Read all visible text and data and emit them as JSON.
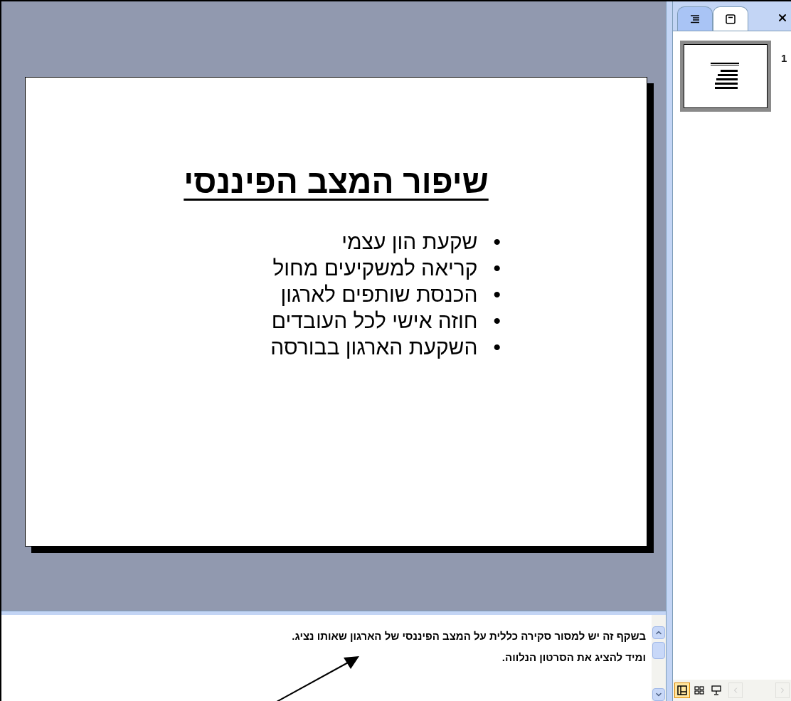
{
  "slide": {
    "title": "שיפור המצב הפיננסי",
    "bullet": "•",
    "items": [
      "שקעת הון עצמי",
      "קריאה למשקיעים מחול",
      "הכנסת שותפים לארגון",
      "חוזה אישי לכל העובדים",
      "השקעת הארגון בבורסה"
    ]
  },
  "notes": {
    "lines": [
      "בשקף זה יש למסור סקירה כללית על המצב הפיננסי של הארגון שאותו נציג.",
      "ומיד להציג את הסרטון הנלווה."
    ]
  },
  "side_panel": {
    "tabs": [
      {
        "kind": "outline",
        "selected": false
      },
      {
        "kind": "slides",
        "selected": true
      }
    ],
    "thumbnails": [
      {
        "number": "1",
        "selected": true
      }
    ]
  },
  "view_buttons": [
    {
      "kind": "normal",
      "selected": true
    },
    {
      "kind": "sorter",
      "selected": false
    },
    {
      "kind": "show",
      "selected": false
    }
  ]
}
